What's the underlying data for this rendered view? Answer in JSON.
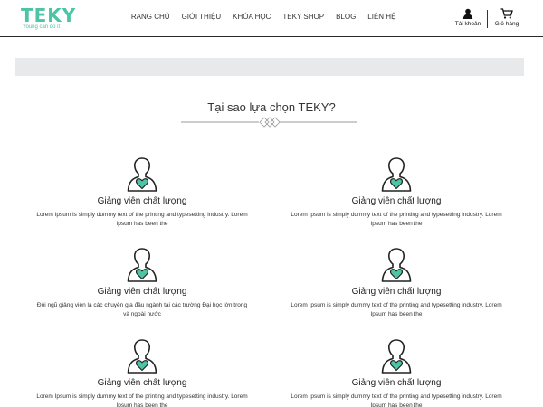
{
  "brand": {
    "name": "TEKY",
    "tagline": "Young can do it"
  },
  "nav": [
    "TRANG CHỦ",
    "GIỚI THIỆU",
    "KHÓA HỌC",
    "TEKY SHOP",
    "BLOG",
    "LIÊN HỆ"
  ],
  "header_actions": {
    "account": "Tài khoản",
    "cart": "Giỏ hàng"
  },
  "section": {
    "title": "Tại sao lựa chọn TEKY?"
  },
  "colors": {
    "accent": "#4cc4a5",
    "banner": "#e8e9ea"
  },
  "features": [
    {
      "title": "Giảng viên chất lượng",
      "description": "Lorem Ipsum is simply dummy text of the printing and typesetting industry. Lorem Ipsum has been the"
    },
    {
      "title": "Giảng viên chất lượng",
      "description": "Lorem Ipsum is simply dummy text of the printing and typesetting industry. Lorem Ipsum has been the"
    },
    {
      "title": "Giảng viên chất lượng",
      "description": "Đội ngũ giảng viên là các chuyên gia đầu ngành tại các trường Đại học lớn trong và ngoài nước"
    },
    {
      "title": "Giảng viên chất lượng",
      "description": "Lorem Ipsum is simply dummy text of the printing and typesetting industry. Lorem Ipsum has been the"
    },
    {
      "title": "Giảng viên chất lượng",
      "description": "Lorem Ipsum is simply dummy text of the printing and typesetting industry. Lorem Ipsum has been the"
    },
    {
      "title": "Giảng viên chất lượng",
      "description": "Lorem Ipsum is simply dummy text of the printing and typesetting industry. Lorem Ipsum has been the"
    }
  ]
}
